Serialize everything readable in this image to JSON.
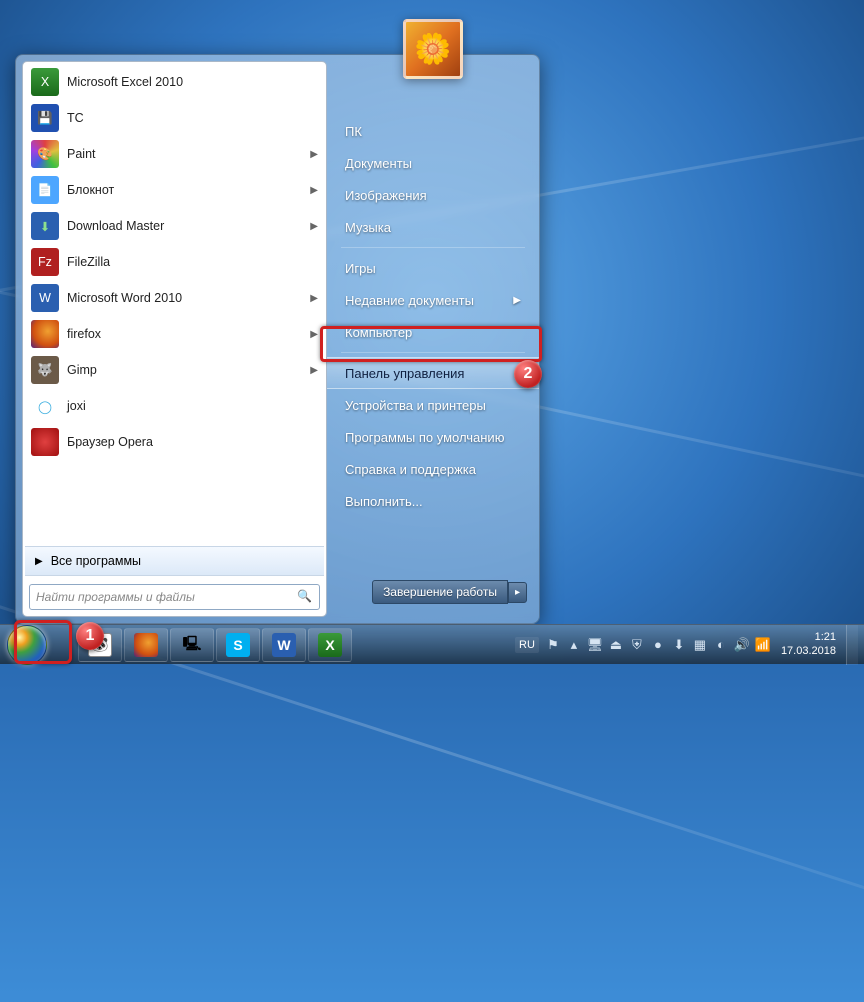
{
  "start_menu": {
    "programs": [
      {
        "label": "Microsoft Excel 2010",
        "icon": "excel-icon",
        "has_submenu": false,
        "icon_class": "ic-excel",
        "glyph": "X"
      },
      {
        "label": "TC",
        "icon": "total-commander-icon",
        "has_submenu": false,
        "icon_class": "ic-tc",
        "glyph": "💾"
      },
      {
        "label": "Paint",
        "icon": "paint-icon",
        "has_submenu": true,
        "icon_class": "ic-paint",
        "glyph": "🎨"
      },
      {
        "label": "Блокнот",
        "icon": "notepad-icon",
        "has_submenu": true,
        "icon_class": "ic-notepad",
        "glyph": "📄"
      },
      {
        "label": "Download Master",
        "icon": "download-master-icon",
        "has_submenu": true,
        "icon_class": "ic-dm",
        "glyph": "⬇"
      },
      {
        "label": "FileZilla",
        "icon": "filezilla-icon",
        "has_submenu": false,
        "icon_class": "ic-fz",
        "glyph": "Fz"
      },
      {
        "label": "Microsoft Word 2010",
        "icon": "word-icon",
        "has_submenu": true,
        "icon_class": "ic-word",
        "glyph": "W"
      },
      {
        "label": "firefox",
        "icon": "firefox-icon",
        "has_submenu": true,
        "icon_class": "ic-ff",
        "glyph": ""
      },
      {
        "label": "Gimp",
        "icon": "gimp-icon",
        "has_submenu": true,
        "icon_class": "ic-gimp",
        "glyph": "🐺"
      },
      {
        "label": "joxi",
        "icon": "joxi-icon",
        "has_submenu": false,
        "icon_class": "ic-joxi",
        "glyph": "◯"
      },
      {
        "label": "Браузер Opera",
        "icon": "opera-icon",
        "has_submenu": false,
        "icon_class": "ic-opera",
        "glyph": ""
      }
    ],
    "all_programs_label": "Все программы",
    "search_placeholder": "Найти программы и файлы",
    "right_items": [
      {
        "label": "ПК",
        "section": 0,
        "submenu": false,
        "highlighted": false
      },
      {
        "label": "Документы",
        "section": 0,
        "submenu": false,
        "highlighted": false
      },
      {
        "label": "Изображения",
        "section": 0,
        "submenu": false,
        "highlighted": false
      },
      {
        "label": "Музыка",
        "section": 0,
        "submenu": false,
        "highlighted": false
      },
      {
        "label": "Игры",
        "section": 1,
        "submenu": false,
        "highlighted": false
      },
      {
        "label": "Недавние документы",
        "section": 1,
        "submenu": true,
        "highlighted": false
      },
      {
        "label": "Компьютер",
        "section": 1,
        "submenu": false,
        "highlighted": false
      },
      {
        "label": "Панель управления",
        "section": 2,
        "submenu": false,
        "highlighted": true
      },
      {
        "label": "Устройства и принтеры",
        "section": 2,
        "submenu": false,
        "highlighted": false
      },
      {
        "label": "Программы по умолчанию",
        "section": 2,
        "submenu": false,
        "highlighted": false
      },
      {
        "label": "Справка и поддержка",
        "section": 2,
        "submenu": false,
        "highlighted": false
      },
      {
        "label": "Выполнить...",
        "section": 2,
        "submenu": false,
        "highlighted": false
      }
    ],
    "shutdown_label": "Завершение работы"
  },
  "taskbar": {
    "items": [
      {
        "name": "panda-icon",
        "class": "ic-panda",
        "glyph": "🐼"
      },
      {
        "name": "firefox-icon",
        "class": "ic-ff",
        "glyph": ""
      },
      {
        "name": "terminal-icon",
        "class": "",
        "glyph": "🖳"
      },
      {
        "name": "skype-icon",
        "class": "ic-skype",
        "glyph": "S"
      },
      {
        "name": "word-icon",
        "class": "ic-word",
        "glyph": "W"
      },
      {
        "name": "excel-icon",
        "class": "ic-excel",
        "glyph": "X"
      }
    ],
    "lang": "RU",
    "tray_icons": [
      "flag-icon",
      "up-icon",
      "monitor-icon",
      "eject-icon",
      "shield-icon",
      "av-icon",
      "dm-icon",
      "image-icon",
      "update-icon",
      "volume-icon",
      "network-icon"
    ],
    "time": "1:21",
    "date": "17.03.2018"
  },
  "markers": {
    "m1": "1",
    "m2": "2"
  }
}
